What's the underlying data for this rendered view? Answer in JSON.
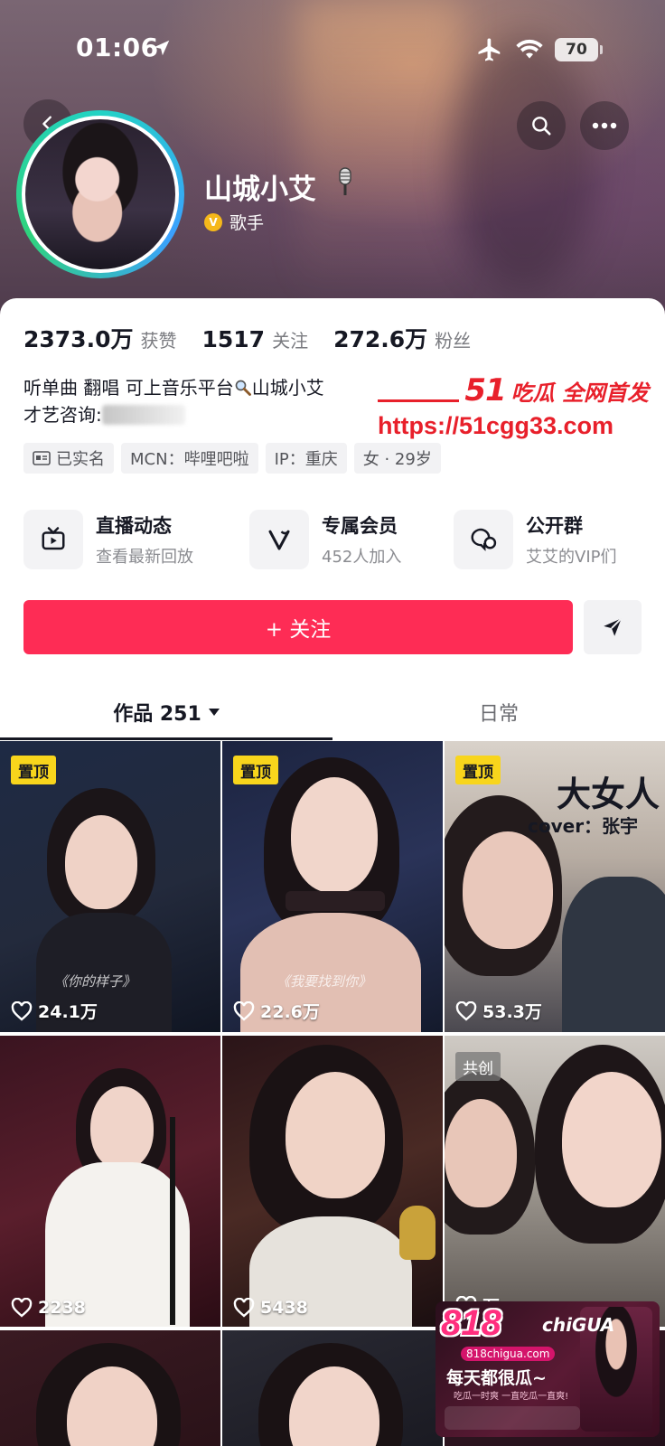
{
  "status_bar": {
    "time": "01:06",
    "battery": "70"
  },
  "profile": {
    "name": "山城小艾",
    "role": "歌手",
    "verified_badge": "V"
  },
  "stats": [
    {
      "value": "2373.0万",
      "label": "获赞"
    },
    {
      "value": "1517",
      "label": "关注"
    },
    {
      "value": "272.6万",
      "label": "粉丝"
    }
  ],
  "bio": {
    "line1_before": "听单曲 翻唱 可上音乐平台",
    "line1_after": "山城小艾",
    "line2": "才艺咨询:"
  },
  "watermark": {
    "brand": "51",
    "slogan": "吃瓜 全网首发",
    "url": "https://51cgg33.com"
  },
  "tags": [
    {
      "label": "已实名",
      "icon": "id-card-icon"
    },
    {
      "label": "MCN：哔哩吧啦"
    },
    {
      "label": "IP：重庆"
    },
    {
      "label": "女 · 29岁"
    }
  ],
  "features": [
    {
      "title": "直播动态",
      "sub": "查看最新回放",
      "icon": "tv-icon"
    },
    {
      "title": "专属会员",
      "sub": "452人加入",
      "icon": "v-icon"
    },
    {
      "title": "公开群",
      "sub": "艾艾的VIP们",
      "icon": "chat-icon"
    }
  ],
  "actions": {
    "follow": "+ 关注"
  },
  "tabs": {
    "works": "作品 251",
    "daily": "日常"
  },
  "videos": [
    {
      "badge": "置顶",
      "likes": "24.1万",
      "caption": "《你的样子》"
    },
    {
      "badge": "置顶",
      "likes": "22.6万",
      "caption": "《我要找到你》"
    },
    {
      "badge": "置顶",
      "likes": "53.3万",
      "overlay_title": "大女人",
      "overlay_sub": "cover：张宇"
    },
    {
      "likes": "2238"
    },
    {
      "likes": "5438"
    },
    {
      "badge": "共创",
      "likes": "万"
    }
  ],
  "ad": {
    "logo": "818",
    "brand": "chiGUA",
    "domain": "818chigua.com",
    "slogan": "每天都很瓜~",
    "sub": "吃瓜一时爽 一直吃瓜一直爽!"
  },
  "colors": {
    "accent": "#fe2c55",
    "pin": "#f8d51c",
    "watermark": "#e8202b"
  }
}
